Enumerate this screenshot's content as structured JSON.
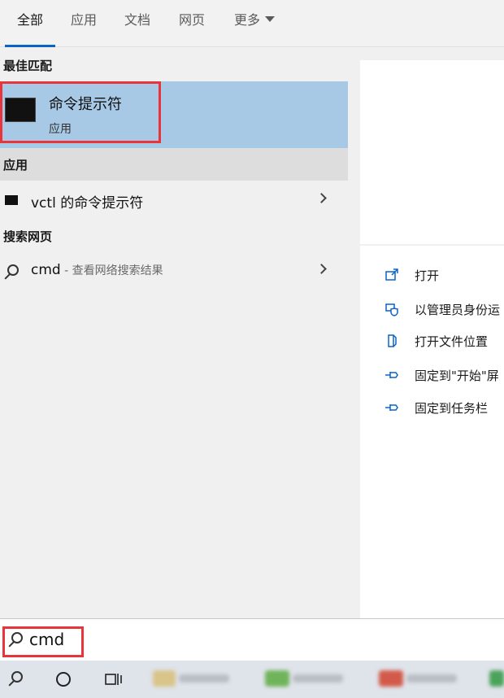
{
  "tabs": [
    {
      "label": "全部",
      "active": true
    },
    {
      "label": "应用",
      "active": false
    },
    {
      "label": "文档",
      "active": false
    },
    {
      "label": "网页",
      "active": false
    },
    {
      "label": "更多",
      "active": false
    }
  ],
  "sections": {
    "best_match": "最佳匹配",
    "apps": "应用",
    "web": "搜索网页"
  },
  "best_match": {
    "title": "命令提示符",
    "subtitle": "应用",
    "icon": "cmd-icon"
  },
  "app_results": [
    {
      "label": "vctl 的命令提示符",
      "icon": "cmd-icon"
    }
  ],
  "web_results": [
    {
      "query": "cmd",
      "suffix": " - 查看网络搜索结果",
      "icon": "search-icon"
    }
  ],
  "actions": [
    {
      "label": "打开",
      "icon": "open-icon"
    },
    {
      "label": "以管理员身份运",
      "icon": "run-as-admin-icon"
    },
    {
      "label": "打开文件位置",
      "icon": "file-location-icon"
    },
    {
      "label": "固定到\"开始\"屏",
      "icon": "pin-icon"
    },
    {
      "label": "固定到任务栏",
      "icon": "pin-icon"
    }
  ],
  "search": {
    "value": "cmd"
  },
  "colors": {
    "accent": "#0a64c8",
    "selection": "#a7c9e6",
    "highlight": "#e8353b"
  }
}
